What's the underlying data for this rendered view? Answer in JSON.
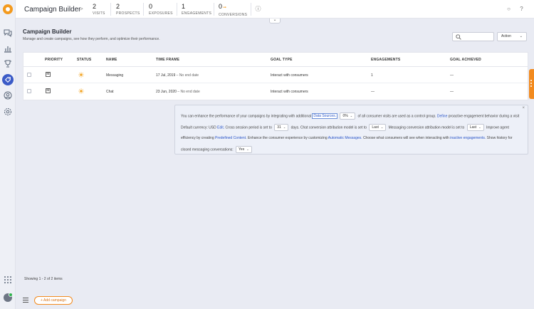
{
  "header": {
    "title": "Campaign Builder",
    "kpis": [
      {
        "value": "2",
        "label": "VISITS"
      },
      {
        "value": "2",
        "label": "PROSPECTS"
      },
      {
        "value": "0",
        "label": "EXPOSURES"
      },
      {
        "value": "1",
        "label": "ENGAGEMENTS"
      },
      {
        "value": "0",
        "label": "CONVERSIONS"
      }
    ]
  },
  "page": {
    "title": "Campaign Builder",
    "subtitle": "Manage and create campaigns, see how they perform, and optimize their performance.",
    "action_label": "Action"
  },
  "table": {
    "headers": [
      "PRIORITY",
      "STATUS",
      "NAME",
      "TIME FRAME",
      "GOAL TYPE",
      "ENGAGEMENTS",
      "GOAL ACHIEVED"
    ],
    "rows": [
      {
        "priority": "M",
        "name": "Messaging",
        "date": "17 Jul, 2019",
        "end": "No end date",
        "goal_type": "Interact with consumers",
        "engagements": "1",
        "goal_achieved": "—"
      },
      {
        "priority": "M",
        "name": "Chat",
        "date": "23 Jun, 2020",
        "end": "No end date",
        "goal_type": "Interact with consumers",
        "engagements": "—",
        "goal_achieved": "—"
      }
    ]
  },
  "info": {
    "l1_a": "You can enhance the performance of your campaigns by integrating with additional",
    "l1_link": "Data Sources.",
    "l1_sel": "0%",
    "l1_b": "of all consumer visits are used as a control group.",
    "l1_link2": "Define",
    "l1_c": "proactive engagement behavior during a visit",
    "l2_a": "Default currency: USD",
    "l2_link": "Edit.",
    "l2_b": "Cross session period is set to",
    "l2_sel1": "31",
    "l2_c": "days. Chat conversion attribution model is set to",
    "l2_sel2": "Last",
    "l2_d": "Messaging conversion attribution model is set to",
    "l2_sel3": "Last",
    "l2_e": "Improve agent",
    "l3_a": "efficiency by creating",
    "l3_link": "Predefined Content.",
    "l3_b": "Enhance the consumer experience by customizing",
    "l3_link2": "Automatic Messages.",
    "l3_c": "Choose what consumers will see when interacting with",
    "l3_link3": "inactive engagements.",
    "l3_d": "Show history for",
    "l4_a": "closed messaging conversations:",
    "l4_sel": "Yes"
  },
  "footer": {
    "showing": "Showing 1 - 2 of 2 items",
    "add_campaign": "+ Add campaign"
  },
  "colors": {
    "accent": "#f28a1e",
    "active_nav": "#3b5bc7",
    "link": "#2a55c8"
  },
  "icons": [
    "logo-icon",
    "chat-icon",
    "chart-icon",
    "trophy-icon",
    "campaign-icon",
    "user-icon",
    "settings-icon",
    "search-icon",
    "apps-grid-icon",
    "menu-icon"
  ]
}
